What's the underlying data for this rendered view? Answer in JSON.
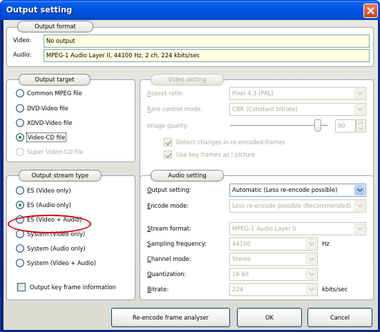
{
  "window": {
    "title": "Output setting"
  },
  "output_format": {
    "title": "Output format",
    "video_label": "Video:",
    "video_value": "No output",
    "audio_label": "Audio:",
    "audio_value": "MPEG-1 Audio Layer II, 44100 Hz, 2 ch, 224 kbits/sec"
  },
  "output_target": {
    "title": "Output target",
    "options": [
      {
        "label": "Common MPEG file",
        "selected": false,
        "enabled": true
      },
      {
        "label": "DVD-Video file",
        "selected": false,
        "enabled": true
      },
      {
        "label": "XDVD-Video file",
        "selected": false,
        "enabled": true
      },
      {
        "label": "Video-CD file",
        "selected": true,
        "enabled": true
      },
      {
        "label": "Super Video-CD file",
        "selected": false,
        "enabled": false
      }
    ]
  },
  "video_setting": {
    "title": "Video setting",
    "aspect_ratio_label": "Aspect ratio:",
    "aspect_ratio_value": "Pixel 4:3 (PAL)",
    "rate_control_label": "Rate control mode:",
    "rate_control_value": "CBR (Constant bitrate)",
    "image_quality_label": "Image quality:",
    "image_quality_value": "90",
    "detect_changes_label": "Detect changes in re-encoded frames",
    "detect_changes_checked": true,
    "use_key_frames_label": "Use key frames as I picture",
    "use_key_frames_checked": true
  },
  "output_stream_type": {
    "title": "Output stream type",
    "options": [
      {
        "label": "ES (Video only)",
        "selected": false
      },
      {
        "label": "ES (Audio only)",
        "selected": true
      },
      {
        "label": "ES (Video + Audio)",
        "selected": false
      },
      {
        "label": "System (Video only)",
        "selected": false
      },
      {
        "label": "System (Audio only)",
        "selected": false
      },
      {
        "label": "System (Video + Audio)",
        "selected": false
      }
    ],
    "key_frame_info_label": "Output key frame information",
    "key_frame_info_checked": false
  },
  "audio_setting": {
    "title": "Audio setting",
    "output_setting_label": "Output setting:",
    "output_setting_value": "Automatic (Less re-encode possible)",
    "encode_mode_label": "Encode mode:",
    "encode_mode_value": "Less re-encode possible (Recommended)",
    "stream_format_label": "Stream format:",
    "stream_format_value": "MPEG-1 Audio Layer II",
    "sampling_frequency_label": "Sampling frequency:",
    "sampling_frequency_value": "44100",
    "sampling_frequency_unit": "Hz",
    "channel_mode_label": "Channel mode:",
    "channel_mode_value": "Stereo",
    "quantization_label": "Quantization:",
    "quantization_value": "16 bit",
    "bitrate_label": "Bitrate:",
    "bitrate_value": "224",
    "bitrate_unit": "kbits/sec"
  },
  "buttons": {
    "analyser": "Re-encode frame analyser",
    "ok": "OK",
    "cancel": "Cancel"
  },
  "colors": {
    "title_bar": "#0054e3",
    "annotation_circle": "#d40000",
    "radio_selected_dot": "#21a121"
  }
}
